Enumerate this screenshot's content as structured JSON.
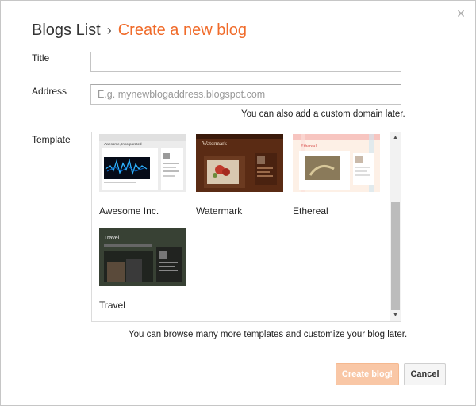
{
  "header": {
    "breadcrumb": "Blogs List",
    "separator": "›",
    "title": "Create a new blog"
  },
  "close_icon": "×",
  "form": {
    "title_label": "Title",
    "title_value": "",
    "address_label": "Address",
    "address_value": "",
    "address_placeholder": "E.g. mynewblogaddress.blogspot.com",
    "address_hint": "You can also add a custom domain later.",
    "template_label": "Template",
    "template_hint": "You can browse many more templates and customize your blog later."
  },
  "templates": [
    {
      "name": "Awesome Inc.",
      "thumb_title": "Awesome, Incorporated"
    },
    {
      "name": "Watermark",
      "thumb_title": "Watermark"
    },
    {
      "name": "Ethereal",
      "thumb_title": "Ethereal"
    },
    {
      "name": "Travel",
      "thumb_title": "Travel"
    }
  ],
  "scrollbar": {
    "up_icon": "▲",
    "down_icon": "▼"
  },
  "buttons": {
    "create": "Create blog!",
    "cancel": "Cancel"
  },
  "colors": {
    "accent": "#f06b2a",
    "primary_button_disabled": "#f9c7a6"
  }
}
